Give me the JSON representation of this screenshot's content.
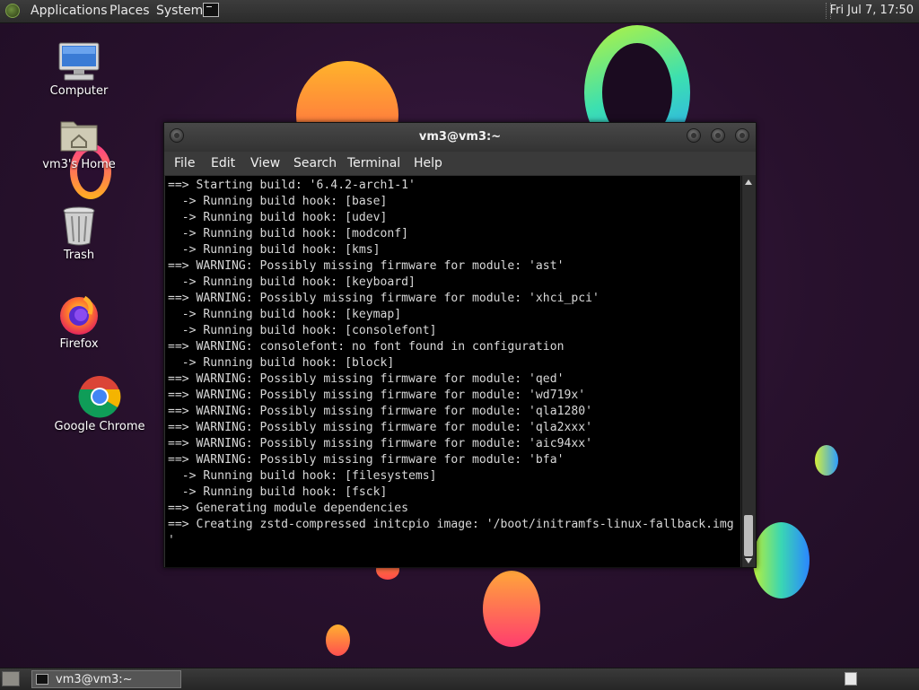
{
  "top_panel": {
    "menus": [
      "Applications",
      "Places",
      "System"
    ],
    "clock": "Fri Jul  7, 17:50"
  },
  "desktop": {
    "icons": [
      {
        "label": "Computer",
        "icon": "computer-icon"
      },
      {
        "label": "vm3's Home",
        "icon": "home-folder-icon"
      },
      {
        "label": "Trash",
        "icon": "trash-icon"
      },
      {
        "label": "Firefox",
        "icon": "firefox-icon"
      },
      {
        "label": "Google Chrome",
        "icon": "chrome-icon"
      }
    ]
  },
  "terminal": {
    "title": "vm3@vm3:~",
    "menu": [
      "File",
      "Edit",
      "View",
      "Search",
      "Terminal",
      "Help"
    ],
    "lines": [
      "==> Starting build: '6.4.2-arch1-1'",
      "  -> Running build hook: [base]",
      "  -> Running build hook: [udev]",
      "  -> Running build hook: [modconf]",
      "  -> Running build hook: [kms]",
      "==> WARNING: Possibly missing firmware for module: 'ast'",
      "  -> Running build hook: [keyboard]",
      "==> WARNING: Possibly missing firmware for module: 'xhci_pci'",
      "  -> Running build hook: [keymap]",
      "  -> Running build hook: [consolefont]",
      "==> WARNING: consolefont: no font found in configuration",
      "  -> Running build hook: [block]",
      "==> WARNING: Possibly missing firmware for module: 'qed'",
      "==> WARNING: Possibly missing firmware for module: 'wd719x'",
      "==> WARNING: Possibly missing firmware for module: 'qla1280'",
      "==> WARNING: Possibly missing firmware for module: 'qla2xxx'",
      "==> WARNING: Possibly missing firmware for module: 'aic94xx'",
      "==> WARNING: Possibly missing firmware for module: 'bfa'",
      "  -> Running build hook: [filesystems]",
      "  -> Running build hook: [fsck]",
      "==> Generating module dependencies",
      "==> Creating zstd-compressed initcpio image: '/boot/initramfs-linux-fallback.img",
      "'"
    ]
  },
  "bottom_panel": {
    "task": "vm3@vm3:~"
  }
}
